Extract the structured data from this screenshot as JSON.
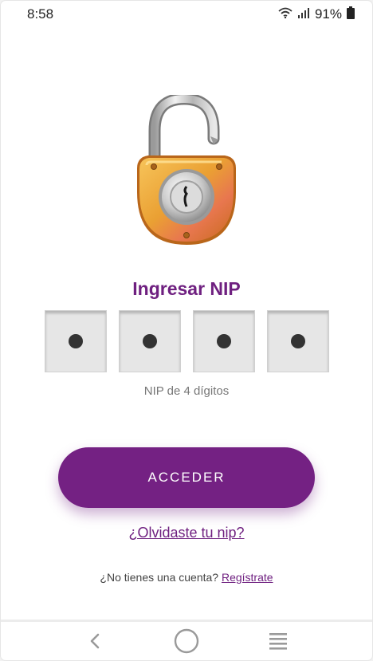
{
  "status_bar": {
    "time": "8:58",
    "battery": "91%",
    "icons": [
      "wifi-icon",
      "signal-icon",
      "battery-icon"
    ]
  },
  "login": {
    "illustration": "open-padlock-icon",
    "title": "Ingresar NIP",
    "pin": {
      "length": 4,
      "filled": 4,
      "hint": "NIP de 4 dígitos"
    },
    "submit_label": "ACCEDER",
    "forgot_label": "¿Olvidaste tu nip?",
    "register_prompt": "¿No tienes una cuenta?",
    "register_label": "Regístrate"
  },
  "navigation": {
    "buttons": [
      "back-icon",
      "home-icon",
      "recents-icon"
    ]
  },
  "colors": {
    "brand": "#742183",
    "pin_box": "#e6e6e6",
    "pin_dot": "#333333"
  }
}
